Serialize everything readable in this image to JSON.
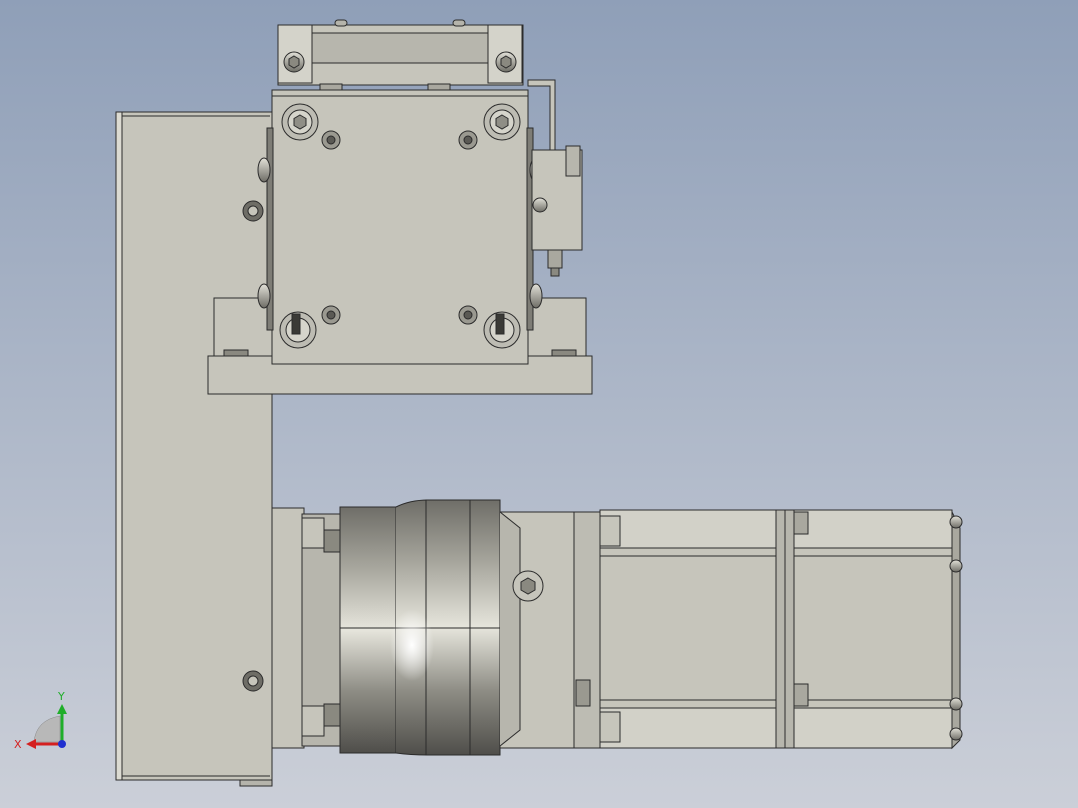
{
  "viewport": {
    "background_top": "#8f9fb8",
    "background_bottom": "#c8ccd6",
    "part_fill": "#c6c5bb",
    "part_shade": "#a9a89f",
    "part_dark": "#7e7d76",
    "edge": "#2b2b2b"
  },
  "triad": {
    "x_label": "X",
    "y_label": "Y",
    "x_color": "#d42020",
    "y_color": "#1fae2a",
    "z_color": "#2030d0"
  },
  "icons": {
    "triad": "coordinate-triad-icon"
  }
}
